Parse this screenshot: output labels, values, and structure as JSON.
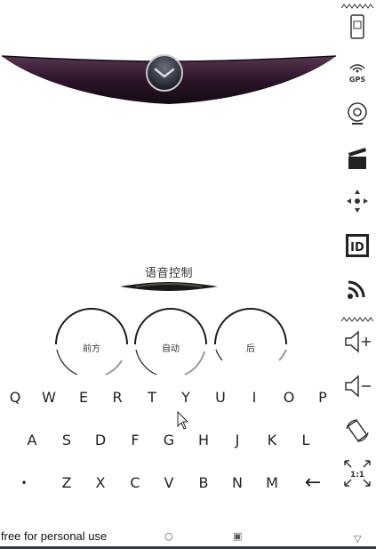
{
  "header": {
    "mode_label": "语音控制"
  },
  "dials": [
    {
      "label": "前方"
    },
    {
      "label": "自动"
    },
    {
      "label": "后"
    }
  ],
  "keyboard": {
    "row1": [
      "Q",
      "W",
      "E",
      "R",
      "T",
      "Y",
      "U",
      "I",
      "O",
      "P"
    ],
    "row2": [
      "A",
      "S",
      "D",
      "F",
      "G",
      "H",
      "J",
      "K",
      "L"
    ],
    "row3": [
      "•",
      "Z",
      "X",
      "C",
      "V",
      "B",
      "N",
      "M",
      "←"
    ]
  },
  "footer": {
    "free_text": "free for personal use",
    "circle_icon": "○",
    "square_icon": "▣",
    "triangle_icon": "▽"
  },
  "sidebar": {
    "items": [
      {
        "icon": "phone-icon"
      },
      {
        "icon": "gps-icon",
        "label": "GPS"
      },
      {
        "icon": "webcam-icon"
      },
      {
        "icon": "clapperboard-icon"
      },
      {
        "icon": "dpad-icon"
      },
      {
        "icon": "id-icon",
        "label": "ID"
      },
      {
        "icon": "rss-icon"
      },
      {
        "icon": "volume-up-icon"
      },
      {
        "icon": "volume-down-icon"
      },
      {
        "icon": "rotate-icon"
      },
      {
        "icon": "aspect-ratio-icon",
        "label": "1:1"
      }
    ]
  },
  "colors": {
    "bowl": "#2b1428",
    "accent_bar": "#2f3745"
  }
}
